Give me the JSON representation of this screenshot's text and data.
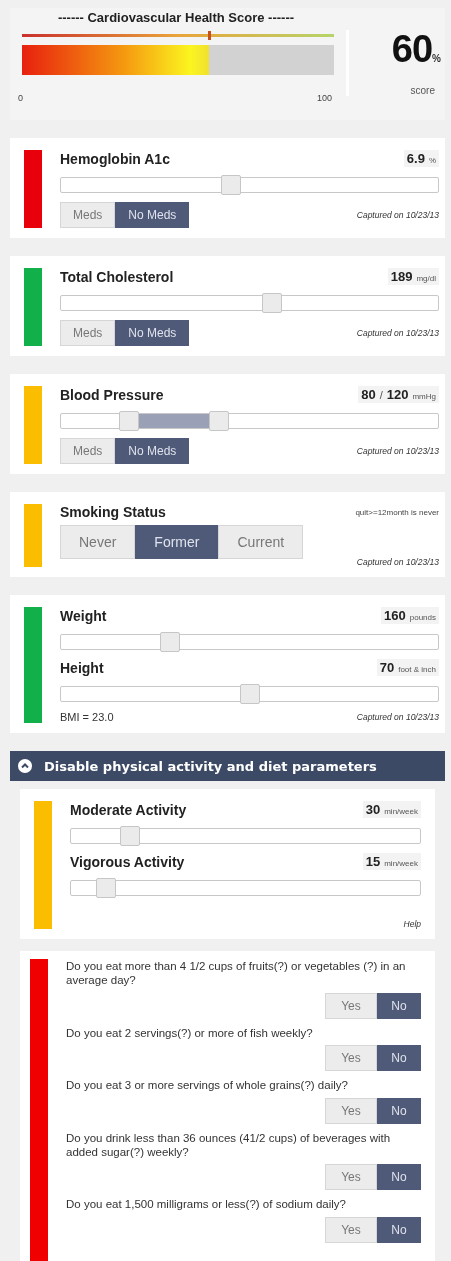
{
  "score": {
    "title": "------ Cardiovascular Health Score ------",
    "level": 0.6,
    "min": "0",
    "max": "100",
    "value": "60",
    "unit": "%",
    "label": "score"
  },
  "cards": [
    {
      "color": "#e8000b",
      "parts": [
        {
          "kind": "heading",
          "label": "Hemoglobin A1c",
          "values": [
            "6.9"
          ],
          "unit": "%"
        },
        {
          "kind": "slider",
          "thumbs": [
            {
              "level": 0.45
            }
          ]
        },
        {
          "kind": "toggle",
          "options": [
            {
              "label": "Meds",
              "selected": false
            },
            {
              "label": "No Meds",
              "selected": true
            }
          ],
          "caption": "Captured on 10/23/13"
        }
      ]
    },
    {
      "color": "#12b04a",
      "parts": [
        {
          "kind": "heading",
          "label": "Total Cholesterol",
          "values": [
            "189"
          ],
          "unit": "mg/dl"
        },
        {
          "kind": "slider",
          "thumbs": [
            {
              "level": 0.56
            }
          ]
        },
        {
          "kind": "toggle",
          "options": [
            {
              "label": "Meds",
              "selected": false
            },
            {
              "label": "No Meds",
              "selected": true
            }
          ],
          "caption": "Captured on 10/23/13"
        }
      ]
    },
    {
      "color": "#fbbd00",
      "parts": [
        {
          "kind": "heading",
          "label": "Blood Pressure",
          "values": [
            "80",
            "120"
          ],
          "separator": "/",
          "unit": "mmHg"
        },
        {
          "kind": "range",
          "thumbs": [
            {
              "level": 0.18
            },
            {
              "level": 0.42
            }
          ]
        },
        {
          "kind": "toggle",
          "options": [
            {
              "label": "Meds",
              "selected": false
            },
            {
              "label": "No Meds",
              "selected": true
            }
          ],
          "caption": "Captured on 10/23/13"
        }
      ]
    },
    {
      "color": "#fbbd00",
      "parts": [
        {
          "kind": "heading",
          "label": "Smoking Status",
          "note": "quit>=12month is never"
        },
        {
          "kind": "choice",
          "options": [
            {
              "label": "Never",
              "selected": false
            },
            {
              "label": "Former",
              "selected": true
            },
            {
              "label": "Current",
              "selected": false
            }
          ],
          "caption": "Captured on 10/23/13"
        }
      ]
    },
    {
      "color": "#12b04a",
      "parts": [
        {
          "kind": "heading",
          "label": "Weight",
          "values": [
            "160"
          ],
          "unit": "pounds"
        },
        {
          "kind": "slider",
          "thumbs": [
            {
              "level": 0.29
            }
          ]
        },
        {
          "kind": "heading",
          "label": "Height",
          "values": [
            "70"
          ],
          "unit": "foot & inch"
        },
        {
          "kind": "slider",
          "thumbs": [
            {
              "level": 0.5
            }
          ]
        },
        {
          "kind": "footer",
          "note": "BMI = 23.0",
          "caption": "Captured on 10/23/13"
        }
      ]
    }
  ],
  "banner": {
    "label": "Disable physical activity and diet parameters"
  },
  "activity": {
    "color": "#fbbd00",
    "parts": [
      {
        "kind": "heading",
        "label": "Moderate Activity",
        "values": [
          "30"
        ],
        "unit": "min/week"
      },
      {
        "kind": "slider",
        "thumbs": [
          {
            "level": 0.17
          }
        ]
      },
      {
        "kind": "heading",
        "label": "Vigorous Activity",
        "values": [
          "15"
        ],
        "unit": "min/week"
      },
      {
        "kind": "slider",
        "thumbs": [
          {
            "level": 0.1
          }
        ]
      },
      {
        "kind": "footer",
        "caption": "Help"
      }
    ]
  },
  "diet": {
    "color": "#f00000",
    "questions": [
      {
        "text": "Do you eat more than 4 1/2 cups of fruits(?) or vegetables (?) in an average day?",
        "options": [
          {
            "label": "Yes",
            "selected": false
          },
          {
            "label": "No",
            "selected": true
          }
        ]
      },
      {
        "text": "Do you eat 2 servings(?) or more of fish weekly?",
        "options": [
          {
            "label": "Yes",
            "selected": false
          },
          {
            "label": "No",
            "selected": true
          }
        ]
      },
      {
        "text": "Do you eat 3 or more servings of whole grains(?) daily?",
        "options": [
          {
            "label": "Yes",
            "selected": false
          },
          {
            "label": "No",
            "selected": true
          }
        ]
      },
      {
        "text": "Do you drink less than 36 ounces (41/2 cups) of beverages with added sugar(?) weekly?",
        "options": [
          {
            "label": "Yes",
            "selected": false
          },
          {
            "label": "No",
            "selected": true
          }
        ]
      },
      {
        "text": "Do you eat 1,500 milligrams or less(?) of sodium daily?",
        "options": [
          {
            "label": "Yes",
            "selected": false
          },
          {
            "label": "No",
            "selected": true
          }
        ]
      }
    ]
  }
}
